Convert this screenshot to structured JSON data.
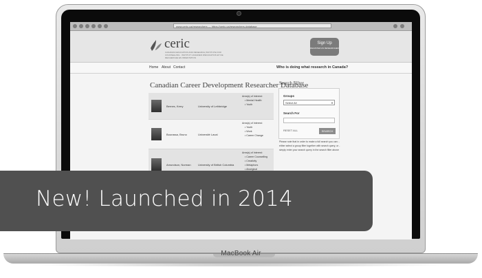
{
  "device": {
    "label": "MacBook Air"
  },
  "browser": {
    "url": "www.ceric.ca/researchers — https://ceric.ca/researchers-database"
  },
  "site": {
    "logo_text": "ceric",
    "logo_subtitle": "CANADIAN EDUCATION AND RESEARCH INSTITUTE FOR COUNSELLING · INSTITUT CANADIEN D'ÉDUCATION ET DE RECHERCHE EN ORIENTATION",
    "signup_label": "Sign Up",
    "signup_sub": "REGISTER AS RESEARCHER",
    "nav": [
      "Home",
      "About",
      "Contact"
    ],
    "nav_question": "Who is doing what research in Canada?"
  },
  "database": {
    "title": "Canadian Career Development Researcher Database",
    "researchers": [
      {
        "name": "Bernes, Kerry",
        "university": "University of Lethbridge",
        "interests_heading": "Area(s) of Interest:",
        "interests": [
          "Mental Health",
          "Youth"
        ]
      },
      {
        "name": "Bourassa, Bruno",
        "university": "Université Laval",
        "interests_heading": "Area(s) of Interest:",
        "interests": [
          "Youth",
          "Work",
          "Career Change"
        ]
      },
      {
        "name": "Amundson, Norman",
        "university": "University of British Columbia",
        "interests_heading": "Area(s) of Interest:",
        "interests": [
          "Career Counselling",
          "Creativity",
          "Metaphors",
          "Aboriginal"
        ]
      }
    ]
  },
  "filter": {
    "title": "Search Filter",
    "groups_label": "Groups",
    "groups_selected": "Select All",
    "search_label": "Search For",
    "reset_label": "RESET ALL",
    "search_button": "SEARCH",
    "note": "Please note that in order to make a full search you can: - either select a group filter together with search query, or - simply enter your search query in the search filter above"
  },
  "banner": {
    "text": "New! Launched in 2014"
  }
}
